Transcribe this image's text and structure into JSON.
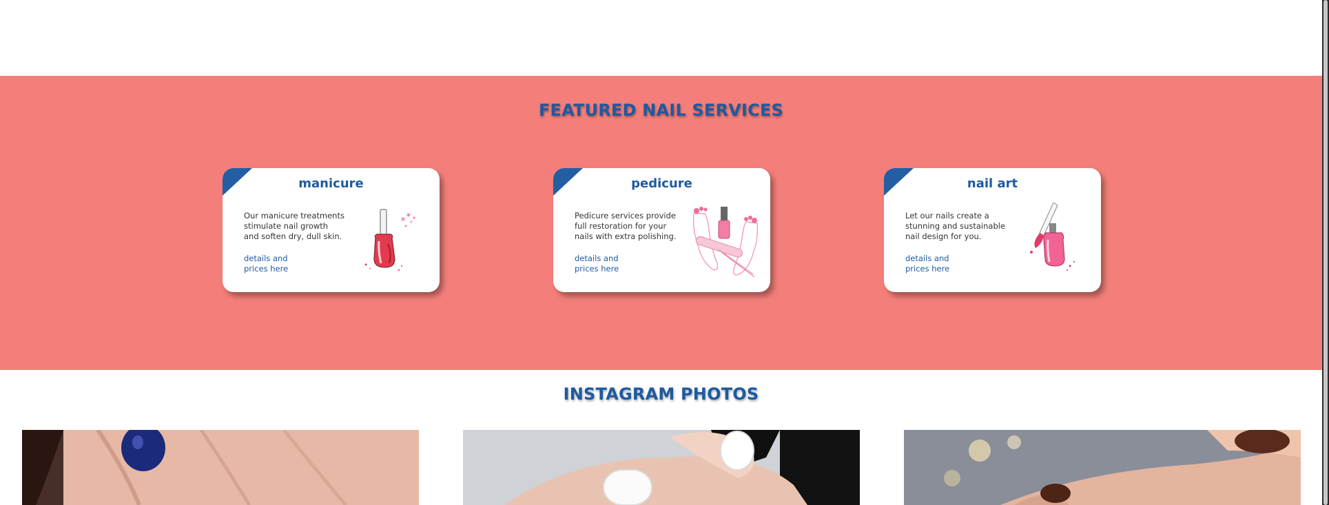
{
  "featured": {
    "title": "FEATURED NAIL SERVICES",
    "background": "#f47f7a",
    "accent": "#235ea3",
    "cards": [
      {
        "title": "manicure",
        "description": "Our manicure treatments\nstimulate nail growth\nand soften dry, dull skin.",
        "link": "details and\nprices here",
        "icon": "nail-polish-bottle-icon"
      },
      {
        "title": "pedicure",
        "description": "Pedicure services provide\nfull restoration for your\nnails with extra polishing.",
        "link": "details and\nprices here",
        "icon": "feet-and-file-icon"
      },
      {
        "title": "nail art",
        "description": "Let our nails create a\nstunning and sustainable\nnail design for you.",
        "link": "details and\nprices here",
        "icon": "open-polish-brush-icon"
      }
    ]
  },
  "instagram": {
    "title": "INSTAGRAM PHOTOS",
    "photos": [
      {
        "subject": "hand with dark blue nail polish"
      },
      {
        "subject": "hand with white manicured nails"
      },
      {
        "subject": "hand with brown nails and bokeh lights"
      }
    ]
  }
}
